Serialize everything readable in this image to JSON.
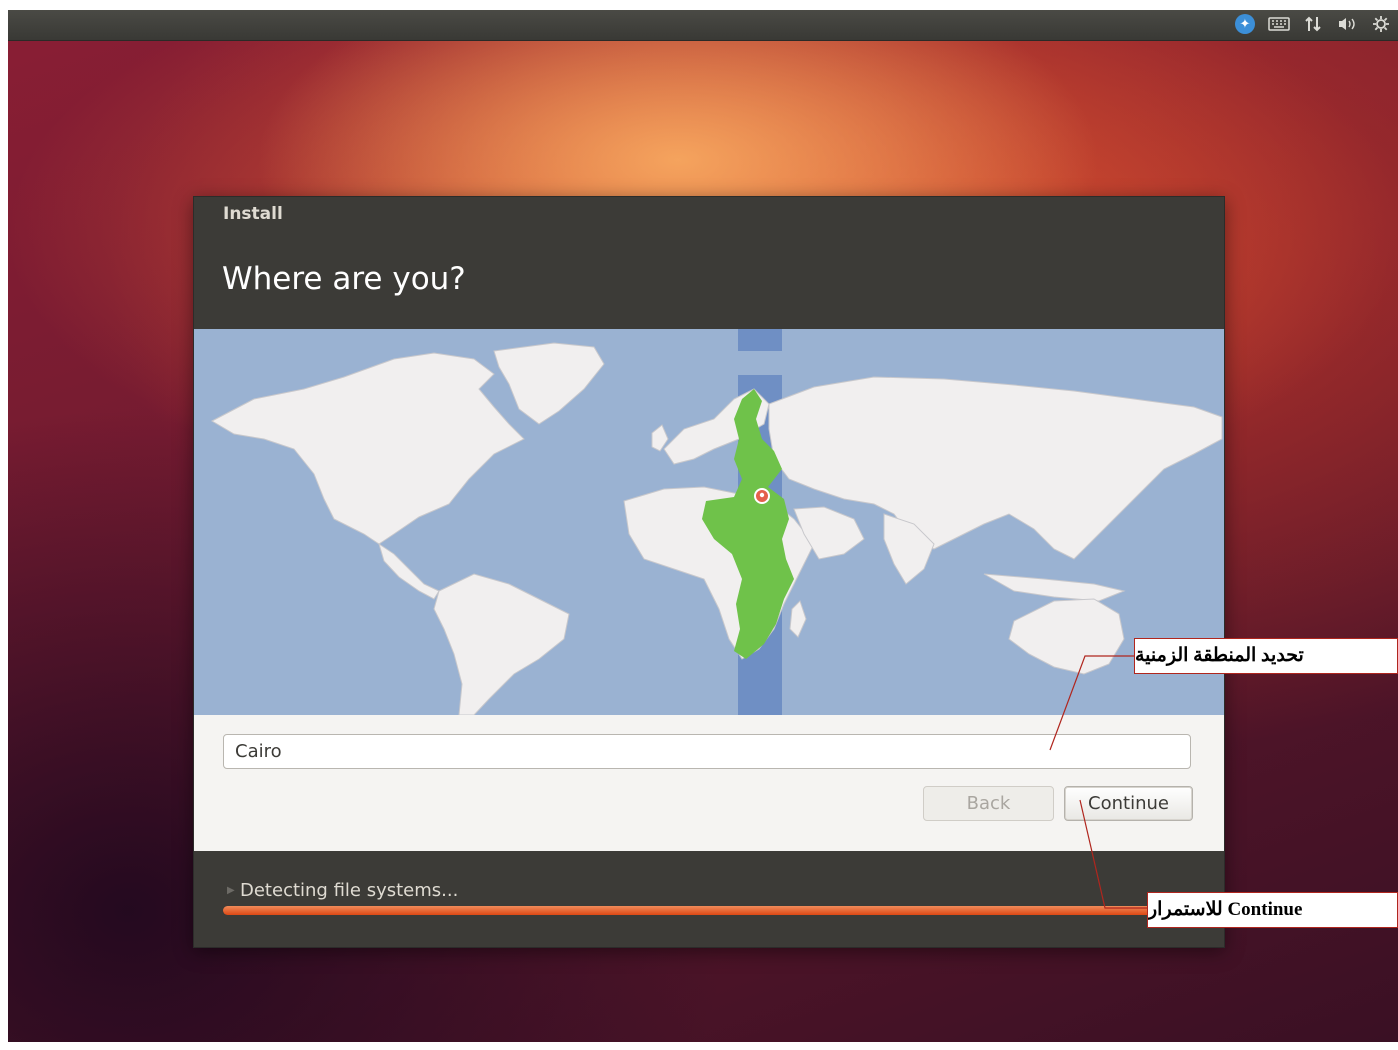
{
  "topbar": {
    "icons": [
      "accessibility-icon",
      "keyboard-icon",
      "network-icon",
      "volume-icon",
      "gear-icon"
    ]
  },
  "window": {
    "title": "Install",
    "heading": "Where are you?"
  },
  "map": {
    "selected_city": "Cairo",
    "highlight_color": "#6fc24a",
    "ocean_color": "#9ab2d2",
    "band_color": "#6f8fc4"
  },
  "timezone": {
    "value": "Cairo"
  },
  "buttons": {
    "back_label": "Back",
    "continue_label": "Continue"
  },
  "status": {
    "text": "Detecting file systems...",
    "progress_percent": 100
  },
  "annotations": {
    "timezone_label": "تحديد المنطقة الزمنية",
    "continue_label": "Continue للاستمرار"
  },
  "colors": {
    "accent": "#dd4814",
    "header_bg": "#3c3b37",
    "callout_border": "#b0261e"
  }
}
